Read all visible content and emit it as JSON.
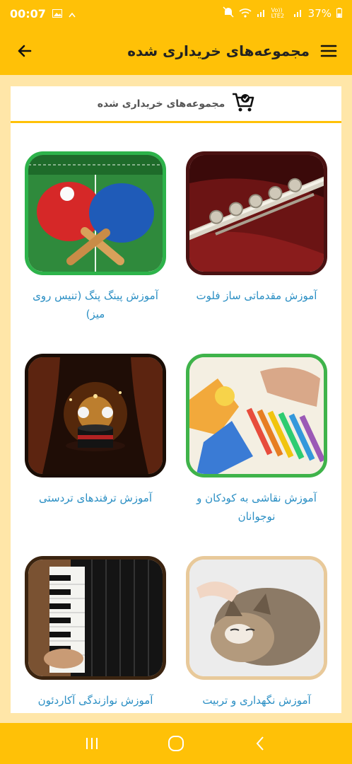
{
  "status": {
    "time": "00:07",
    "battery": "37%",
    "volte": "Vo)) LTE2"
  },
  "app_bar": {
    "title": "مجموعه‌های خریداری شده"
  },
  "section": {
    "title": "مجموعه‌های خریداری شده"
  },
  "courses": [
    {
      "title": "آموزش مقدماتی ساز فلوت",
      "image": "flute"
    },
    {
      "title": "آموزش پینگ پنگ (تنیس روی میز)",
      "image": "ping-pong"
    },
    {
      "title": "آموزش نقاشی به کودکان و نوجوانان",
      "image": "painting"
    },
    {
      "title": "آموزش ترفندهای تردستی",
      "image": "magic"
    },
    {
      "title": "آموزش نگهداری و تربیت",
      "image": "cat"
    },
    {
      "title": "آموزش نوازندگی آکاردئون",
      "image": "accordion"
    }
  ],
  "colors": {
    "accent": "#FFC107",
    "link": "#2B8FC4",
    "background": "#FFE6A8"
  }
}
